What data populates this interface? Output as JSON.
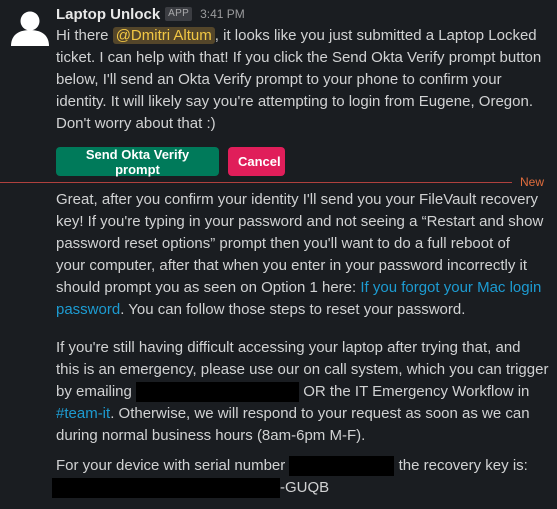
{
  "message": {
    "sender": "Laptop Unlock",
    "badge": "APP",
    "time": "3:41 PM"
  },
  "intro": {
    "text_before": "Hi there ",
    "mention": "@Dmitri Altum",
    "line1_after": ", it looks like you just submitted a Laptop Locked",
    "line2": "ticket. I can help with that! If you click the Send Okta Verify prompt button",
    "line3": "below, I'll send an Okta Verify prompt to your phone to confirm your",
    "line4": "identity. It will likely say you're attempting to login from Eugene, Oregon.",
    "line5": "Don't worry about that :)"
  },
  "buttons": {
    "send_okta": "Send Okta Verify prompt",
    "cancel": "Cancel"
  },
  "divider": {
    "label": "New"
  },
  "recovery_msg": {
    "line1": "Great, after you confirm your identity I'll send you your FileVault recovery",
    "line2": "key! If you're typing in your password and not seeing a “Restart and show",
    "line3": "password reset options” prompt then you'll want to do a full reboot of",
    "line4": "your computer, after that when you enter in your password incorrectly it",
    "line5_before": "should prompt you as seen on Option 1 here: ",
    "link_part1": "If you forgot your Mac login",
    "link_part2": "password",
    "line6_after": ". You can follow those steps to reset your password."
  },
  "emergency_msg": {
    "line1": "If you're still having difficult accessing your laptop after trying that, and",
    "line2": "this is an emergency, please use our on call system, which you can trigger",
    "line3_before": "by emailing ",
    "line3_after": " OR the IT Emergency Workflow in",
    "channel": "#team-it",
    "line4_after": ". Otherwise, we will respond to your request as soon as we can",
    "line5": "during normal business hours (8am-6pm M-F)."
  },
  "serial_msg": {
    "before": "For your device with serial number ",
    "after": " the recovery key is:",
    "key_suffix": "-GUQB"
  },
  "colors": {
    "background": "#1a1d21",
    "text": "#d1d2d3",
    "link": "#1d9bd1",
    "mention_text": "#f2c744",
    "mention_bg": "#54462a",
    "primary_button": "#007a5a",
    "danger_button": "#e01e5a",
    "new_divider": "#b0413e",
    "new_label": "#e06c3c"
  }
}
